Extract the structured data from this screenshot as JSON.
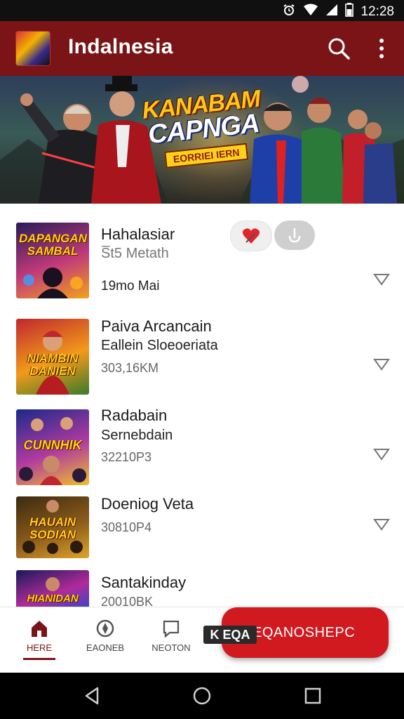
{
  "status_bar": {
    "time": "12:28"
  },
  "app_bar": {
    "title": "Indalnesia"
  },
  "banner": {
    "line1": "KANABAM",
    "line2": "CAPNGA",
    "subtitle": "EORRIEI IERN"
  },
  "list": [
    {
      "thumb_caption": "DAPANGAN SAMBAL",
      "title": "Hahalasiar",
      "subtitle": "S̅t5 Metath",
      "meta": "19mo Mai",
      "colors": [
        "#2a1a5a",
        "#c23a7a",
        "#f2a21a"
      ]
    },
    {
      "thumb_caption": "NIAMBIN DANIEN",
      "title": "Paiva Arcancain",
      "subtitle": "Eallein Sloeoeriata",
      "meta": "303,16KM",
      "colors": [
        "#c0272d",
        "#f29a1a",
        "#3a7a2a"
      ]
    },
    {
      "thumb_caption": "CUNNHIK",
      "title": "Radabain",
      "subtitle": "Sernebdain",
      "meta": "32210P3",
      "colors": [
        "#1a2a8a",
        "#b03aa0",
        "#f0c02a"
      ]
    },
    {
      "thumb_caption": "HAUAIN SODIAN",
      "title": "Doeniog Veta",
      "subtitle": "",
      "meta": "30810P4",
      "colors": [
        "#3a2a10",
        "#8a5a1a",
        "#e0a42a"
      ]
    },
    {
      "thumb_caption": "HIANIDAN",
      "title": "Santakinday",
      "subtitle": "",
      "meta": "20010BK",
      "colors": [
        "#1a1a5a",
        "#b02a9a",
        "#2a4ad0"
      ]
    }
  ],
  "bottom_nav": {
    "items": [
      {
        "label": "HERE"
      },
      {
        "label": "EAONEB"
      },
      {
        "label": "NEOTON"
      }
    ]
  },
  "k_badge": "K EQA",
  "fab": {
    "label": "EQANOSHEPC"
  },
  "colors": {
    "primary": "#7a1416",
    "accent": "#d01a20"
  }
}
